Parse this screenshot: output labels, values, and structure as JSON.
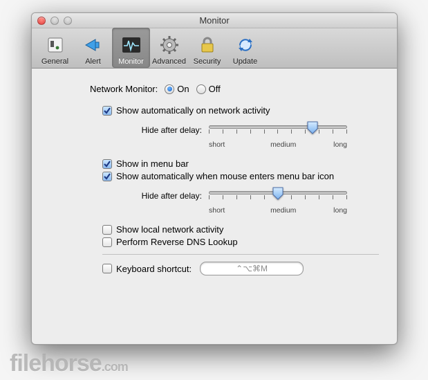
{
  "window": {
    "title": "Monitor"
  },
  "toolbar": {
    "items": [
      {
        "name": "general",
        "label": "General"
      },
      {
        "name": "alert",
        "label": "Alert"
      },
      {
        "name": "monitor",
        "label": "Monitor",
        "selected": true
      },
      {
        "name": "advanced",
        "label": "Advanced"
      },
      {
        "name": "security",
        "label": "Security"
      },
      {
        "name": "update",
        "label": "Update"
      }
    ]
  },
  "content": {
    "network_monitor_label": "Network Monitor:",
    "on_label": "On",
    "off_label": "Off",
    "network_monitor_value": "On",
    "show_auto_activity": {
      "label": "Show automatically on network activity",
      "checked": true
    },
    "slider1": {
      "label": "Hide after delay:",
      "ticks": [
        "short",
        "medium",
        "long"
      ],
      "value_percent": 75
    },
    "show_menu_bar": {
      "label": "Show in menu bar",
      "checked": true
    },
    "show_auto_hover": {
      "label": "Show automatically when mouse enters menu bar icon",
      "checked": true
    },
    "slider2": {
      "label": "Hide after delay:",
      "ticks": [
        "short",
        "medium",
        "long"
      ],
      "value_percent": 50
    },
    "show_local": {
      "label": "Show local network activity",
      "checked": false
    },
    "reverse_dns": {
      "label": "Perform Reverse DNS Lookup",
      "checked": false
    },
    "kb_shortcut": {
      "label": "Keyboard shortcut:",
      "checked": false,
      "value": "⌃⌥⌘M"
    }
  },
  "watermark": {
    "brand": "filehorse",
    "tld": ".com"
  }
}
